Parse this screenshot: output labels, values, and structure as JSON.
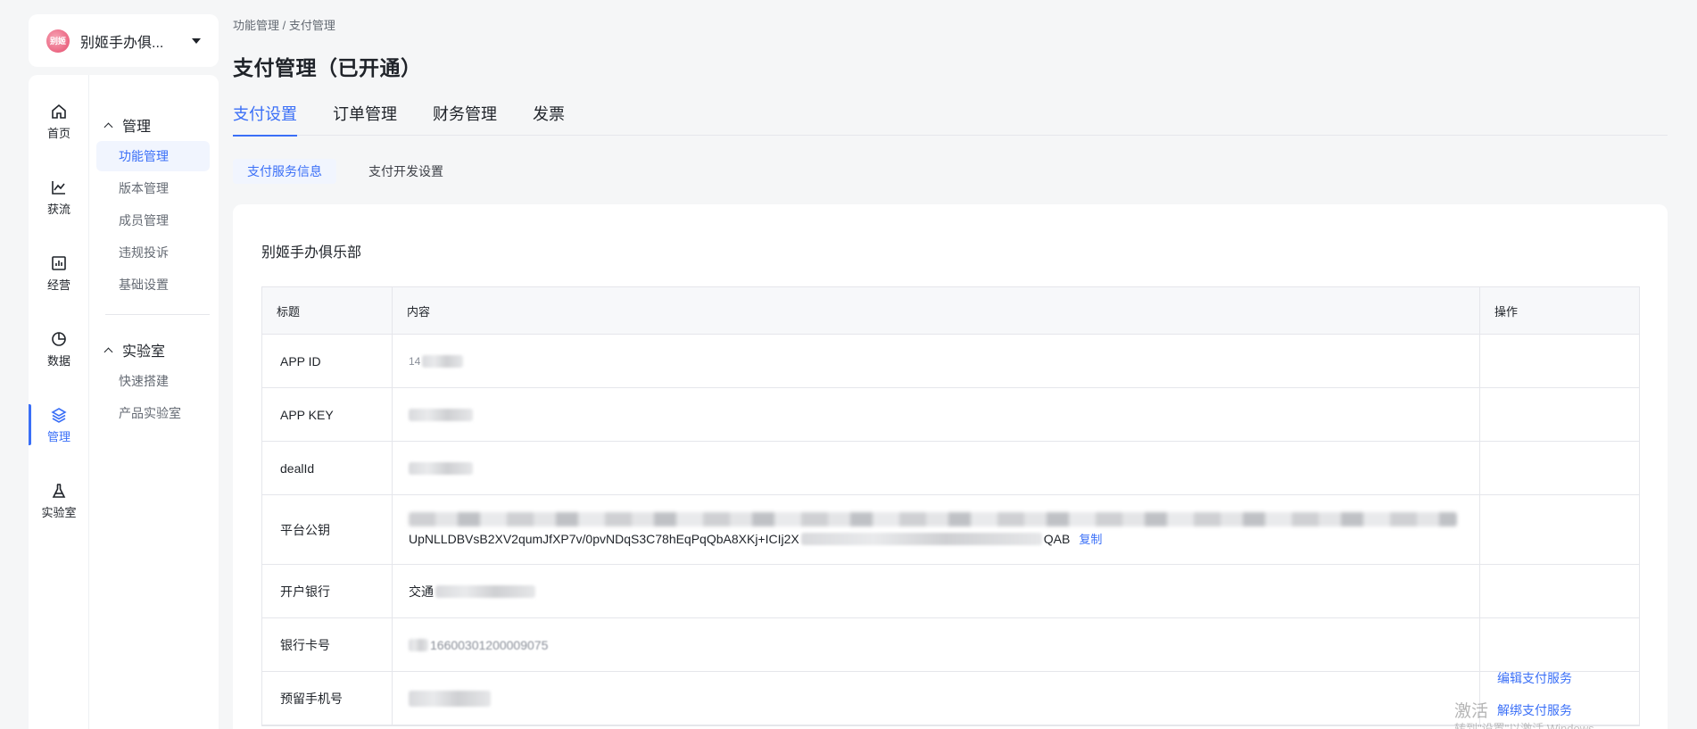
{
  "app": {
    "name": "别姬手办俱..."
  },
  "rail": [
    {
      "label": "首页",
      "icon": "home-icon"
    },
    {
      "label": "获流",
      "icon": "trend-chart-icon"
    },
    {
      "label": "经营",
      "icon": "dashboard-icon"
    },
    {
      "label": "数据",
      "icon": "pie-chart-icon"
    },
    {
      "label": "管理",
      "icon": "layers-icon",
      "active": true
    },
    {
      "label": "实验室",
      "icon": "flask-icon"
    }
  ],
  "subnav": {
    "group1": {
      "title": "管理",
      "items": [
        "功能管理",
        "版本管理",
        "成员管理",
        "违规投诉",
        "基础设置"
      ]
    },
    "group2": {
      "title": "实验室",
      "items": [
        "快速搭建",
        "产品实验室"
      ]
    }
  },
  "breadcrumb": "功能管理 / 支付管理",
  "page_title": "支付管理（已开通）",
  "tabs": [
    "支付设置",
    "订单管理",
    "财务管理",
    "发票"
  ],
  "subtabs": [
    "支付服务信息",
    "支付开发设置"
  ],
  "merchant_name": "别姬手办俱乐部",
  "table": {
    "headers": [
      "标题",
      "内容",
      "操作"
    ],
    "rows": [
      {
        "title": "APP ID",
        "value": "14"
      },
      {
        "title": "APP KEY",
        "value": ""
      },
      {
        "title": "dealId",
        "value": ""
      },
      {
        "title": "平台公钥",
        "value_line2": "UpNLLDBVsB2XV2qumJfXP7v/0pvNDqS3C78hEqPqQbA8XKj+ICIj2X",
        "value_tail": "QAB",
        "copy": "复制"
      },
      {
        "title": "开户银行",
        "value": "交通"
      },
      {
        "title": "银行卡号",
        "value": "16600301200009075"
      },
      {
        "title": "预留手机号",
        "value": ""
      }
    ],
    "actions": [
      "编辑支付服务",
      "解绑支付服务"
    ]
  },
  "watermark": {
    "line1": "激活",
    "line2": "转到\"设置\"以激活 Windows。"
  }
}
